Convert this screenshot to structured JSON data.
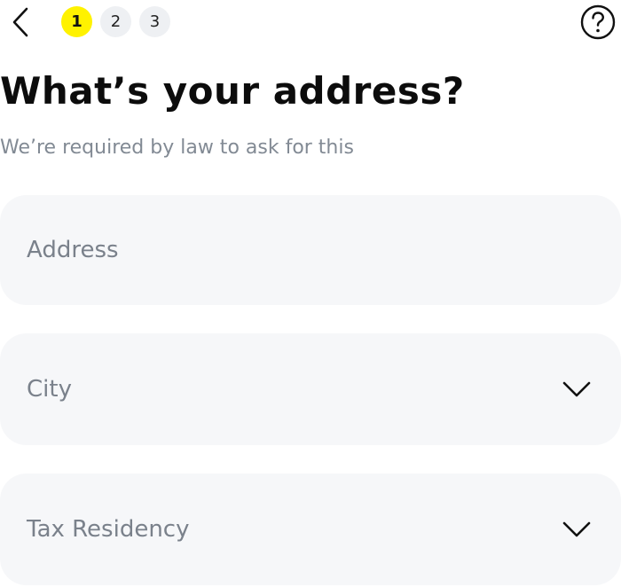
{
  "header": {
    "back_icon": "chevron-left-icon",
    "help_icon": "question-circle-icon",
    "steps": [
      {
        "label": "1",
        "active": true
      },
      {
        "label": "2",
        "active": false
      },
      {
        "label": "3",
        "active": false
      }
    ],
    "active_step_color": "#fff200"
  },
  "page": {
    "title": "What’s your address?",
    "subtitle": "We’re required by law to ask for this"
  },
  "form": {
    "address": {
      "placeholder": "Address"
    },
    "city": {
      "placeholder": "City",
      "icon": "chevron-down-icon"
    },
    "tax_residency": {
      "placeholder": "Tax Residency",
      "icon": "chevron-down-icon"
    }
  }
}
